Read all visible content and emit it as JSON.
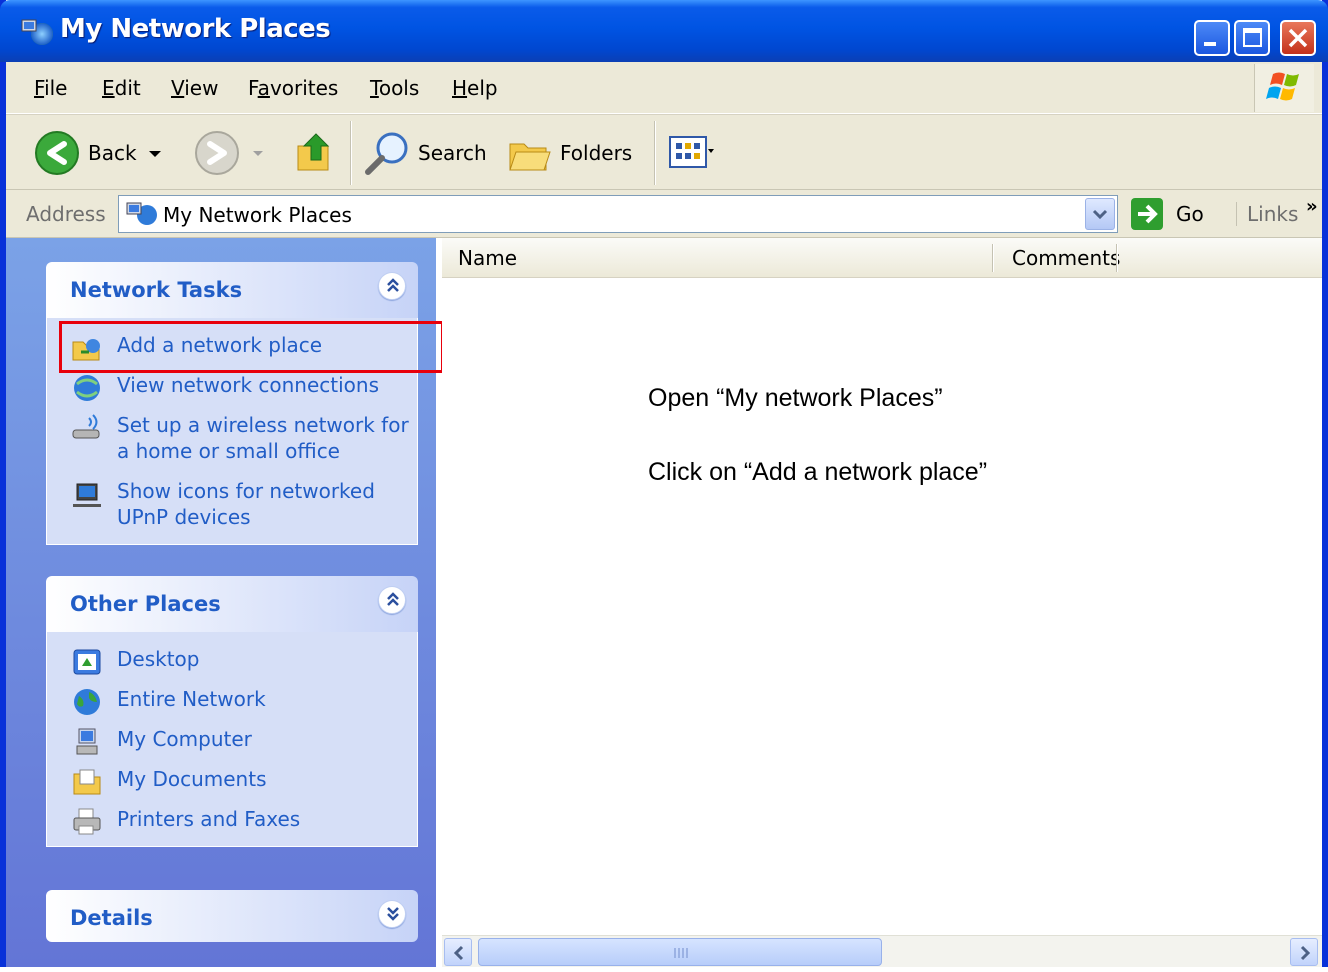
{
  "window": {
    "title": "My Network Places"
  },
  "menu": [
    {
      "pre": "",
      "ul": "F",
      "post": "ile"
    },
    {
      "pre": "",
      "ul": "E",
      "post": "dit"
    },
    {
      "pre": "",
      "ul": "V",
      "post": "iew"
    },
    {
      "pre": "F",
      "ul": "a",
      "post": "vorites"
    },
    {
      "pre": "",
      "ul": "T",
      "post": "ools"
    },
    {
      "pre": "",
      "ul": "H",
      "post": "elp"
    }
  ],
  "toolbar": {
    "back": "Back",
    "search": "Search",
    "folders": "Folders"
  },
  "address": {
    "label": "Address",
    "value": "My Network Places",
    "go": "Go",
    "links": "Links"
  },
  "panels": {
    "network_tasks": {
      "title": "Network Tasks",
      "items": [
        {
          "label": "Add a network place",
          "icon": "add-network-place-icon"
        },
        {
          "label": "View network connections",
          "icon": "network-connections-icon"
        },
        {
          "label": "Set up a wireless network for a home or small office",
          "icon": "wireless-network-icon"
        },
        {
          "label": "Show icons for networked UPnP devices",
          "icon": "upnp-device-icon"
        }
      ]
    },
    "other_places": {
      "title": "Other Places",
      "items": [
        {
          "label": "Desktop",
          "icon": "desktop-icon"
        },
        {
          "label": "Entire Network",
          "icon": "globe-icon"
        },
        {
          "label": "My Computer",
          "icon": "computer-icon"
        },
        {
          "label": "My Documents",
          "icon": "documents-icon"
        },
        {
          "label": "Printers and Faxes",
          "icon": "printer-icon"
        }
      ]
    },
    "details": {
      "title": "Details"
    }
  },
  "list": {
    "columns": [
      "Name",
      "Comments"
    ]
  },
  "instructions": {
    "line1": "Open “My network Places”",
    "line2": "Click on “Add a network place”"
  },
  "colors": {
    "titlebar": "#0054e3",
    "task_link": "#215dc6",
    "highlight": "#e8000b",
    "taskpane": "#7ba2e7"
  }
}
